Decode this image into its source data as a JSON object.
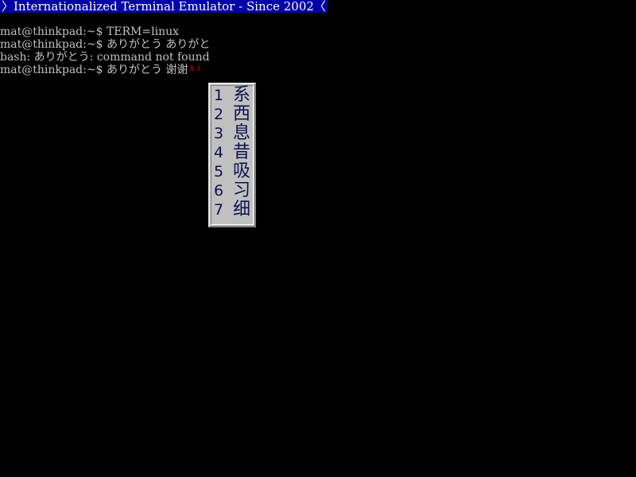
{
  "banner": {
    "text": "〉Internationalized Terminal Emulator - Since 2002〈"
  },
  "terminal": {
    "lines": [
      "mat@thinkpad:~$ TERM=linux",
      "mat@thinkpad:~$ ありがとう ありがと",
      "bash: ありがとう: command not found"
    ],
    "current_prompt": "mat@thinkpad:~$ ありがとう ",
    "preedit_text": "谢谢",
    "ime_status": "x i"
  },
  "candidates": [
    {
      "number": "1",
      "char": "系"
    },
    {
      "number": "2",
      "char": "西"
    },
    {
      "number": "3",
      "char": "息"
    },
    {
      "number": "4",
      "char": "昔"
    },
    {
      "number": "5",
      "char": "吸"
    },
    {
      "number": "6",
      "char": "习"
    },
    {
      "number": "7",
      "char": "细"
    }
  ],
  "colors": {
    "banner_bg": "#0000a8",
    "banner_fg": "#ffffff",
    "terminal_bg": "#000000",
    "terminal_fg": "#c0c0c0",
    "ime_status": "#d00000",
    "candidate_bg": "#c0c0c0",
    "candidate_fg": "#101050"
  }
}
